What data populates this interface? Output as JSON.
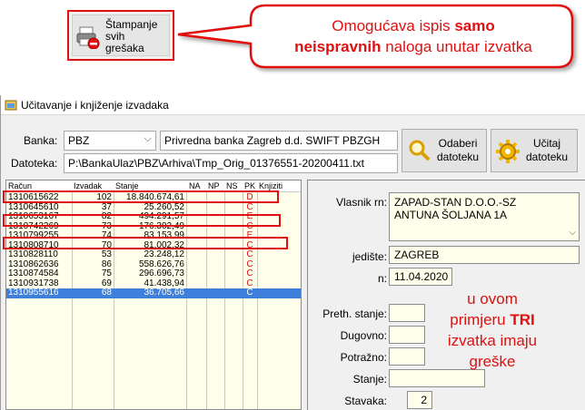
{
  "print_button": {
    "label_lines": [
      "Štampanje",
      "svih",
      "grešaka"
    ]
  },
  "callout_top": {
    "line1_a": "Omogućava ispis ",
    "line1_b": "samo",
    "line2_a": "neispravnih",
    "line2_b": " naloga unutar izvatka"
  },
  "window": {
    "title": "Učitavanje i knjiženje izvadaka",
    "banka_label": "Banka:",
    "banka_value": "PBZ",
    "banka_name": "Privredna banka Zagreb d.d. SWIFT PBZGH",
    "datoteka_label": "Datoteka:",
    "datoteka_value": "P:\\BankaUlaz\\PBZ\\Arhiva\\Tmp_Orig_01376551-20200411.txt",
    "odaberi_label": [
      "Odaberi",
      "datoteku"
    ],
    "ucitaj_label": [
      "Učitaj",
      "datoteku"
    ]
  },
  "list": {
    "headers": [
      "Račun",
      "Izvadak",
      "Stanje",
      "NA",
      "NP",
      "NS",
      "PK",
      "Knjiziti"
    ],
    "rows": [
      {
        "racun": "1310615622",
        "izvadak": "102",
        "stanje": "18.840.674,61",
        "pk": "D"
      },
      {
        "racun": "1310645610",
        "izvadak": "37",
        "stanje": "25.260,52",
        "pk": "C"
      },
      {
        "racun": "1310653167",
        "izvadak": "82",
        "stanje": "494.291,57",
        "pk": "E"
      },
      {
        "racun": "1310742269",
        "izvadak": "73",
        "stanje": "176.302,49",
        "pk": "C"
      },
      {
        "racun": "1310799255",
        "izvadak": "74",
        "stanje": "83.153,99",
        "pk": "E"
      },
      {
        "racun": "1310808710",
        "izvadak": "70",
        "stanje": "81.002,32",
        "pk": "C"
      },
      {
        "racun": "1310828110",
        "izvadak": "53",
        "stanje": "23.248,12",
        "pk": "C"
      },
      {
        "racun": "1310862636",
        "izvadak": "86",
        "stanje": "558.626,76",
        "pk": "C"
      },
      {
        "racun": "1310874584",
        "izvadak": "75",
        "stanje": "296.696,73",
        "pk": "C"
      },
      {
        "racun": "1310931738",
        "izvadak": "69",
        "stanje": "41.438,94",
        "pk": "C"
      },
      {
        "racun": "1310955616",
        "izvadak": "68",
        "stanje": "36.705,66",
        "pk": "C"
      }
    ]
  },
  "details": {
    "vlasnik_label": "Vlasnik rn:",
    "vlasnik_lines": [
      "ZAPAD-STAN D.O.O.-SZ",
      "ANTUNA ŠOLJANA 1A"
    ],
    "sjediste_label": "jedište:",
    "sjediste_value": "ZAGREB",
    "datum_label": "n:",
    "datum_value": "11.04.2020",
    "preth_label": "Preth. stanje:",
    "dugovno_label": "Dugovno:",
    "potrazno_label": "Potražno:",
    "stanje_label": "Stanje:",
    "stavaka_label": "Stavaka:",
    "stavaka_value": "2"
  },
  "callout_bottom": {
    "line1": "u ovom",
    "line2_a": "primjeru ",
    "line2_b": "TRI",
    "line3": "izvatka imaju",
    "line4": "greške"
  }
}
